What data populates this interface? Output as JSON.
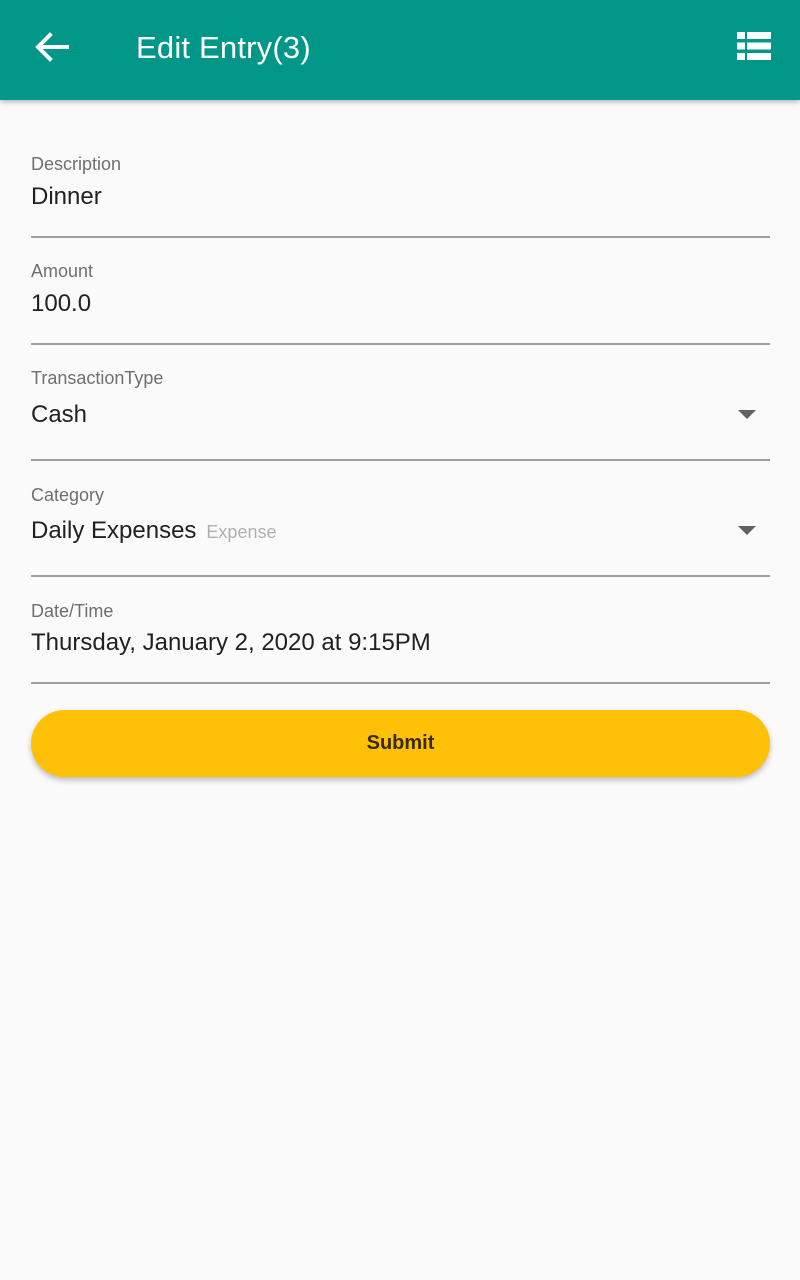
{
  "appbar": {
    "title": "Edit Entry(3)",
    "back_icon": "arrow-back-icon",
    "list_icon": "list-view-icon",
    "color": "#009688"
  },
  "form": {
    "description": {
      "label": "Description",
      "value": "Dinner"
    },
    "amount": {
      "label": "Amount",
      "value": "100.0"
    },
    "transaction_type": {
      "label": "TransactionType",
      "value": "Cash"
    },
    "category": {
      "label": "Category",
      "value": "Daily Expenses",
      "subtext": "Expense"
    },
    "datetime": {
      "label": "Date/Time",
      "value": "Thursday, January 2, 2020 at 9:15PM"
    }
  },
  "submit": {
    "label": "Submit",
    "color": "#ffc107"
  }
}
